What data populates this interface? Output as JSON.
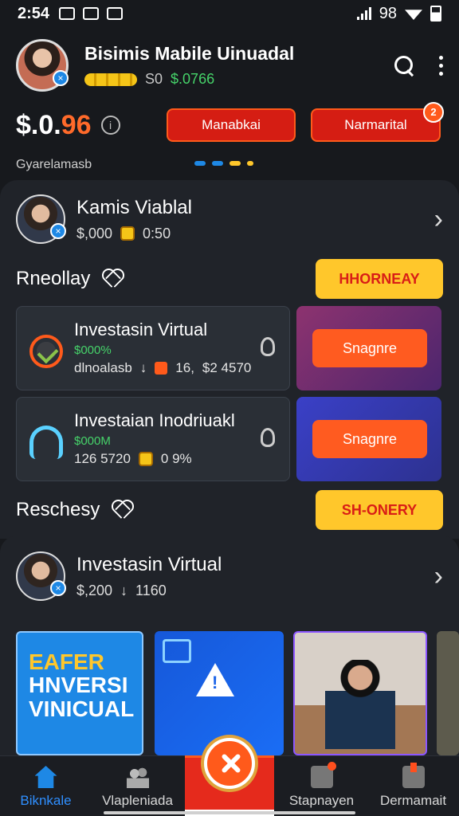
{
  "status_bar": {
    "time": "2:54",
    "right_text": "98"
  },
  "header": {
    "app_name": "Bisimis Mabile Uinuadal",
    "meta_left": "S0",
    "meta_value": "$.0766"
  },
  "balance": {
    "main_prefix": "$.0.",
    "main_accent": "96",
    "button_left": "Manabkai",
    "button_right": "Narmarital",
    "badge_count": "2",
    "subtitle": "Gyarelamasb"
  },
  "top_user": {
    "name": "Kamis Viablal",
    "amount": "$,000",
    "stat": "0:50"
  },
  "section_one": {
    "title": "Rneollay",
    "button": "HHORNEAY"
  },
  "investments": [
    {
      "title": "Investasin Virtual",
      "subtitle": "$000%",
      "meta_text": "dlnoalasb",
      "meta_number": "16,",
      "meta_value": "$2 4570",
      "action": "Snagnre"
    },
    {
      "title": "Investaian Inodriuakl",
      "subtitle": "$000M",
      "meta_text": "126 5720",
      "meta_number": "",
      "meta_value": "0 9%",
      "action": "Snagnre"
    }
  ],
  "section_two": {
    "title": "Reschesy",
    "button": "SH-ONERY"
  },
  "featured_user": {
    "name": "Investasin Virtual",
    "amount": "$,200",
    "stat": "1160"
  },
  "thumbnails": {
    "first_text_1": "EAFER",
    "first_text_2": "HNVERSI",
    "first_text_3": "VINICUAL"
  },
  "bottom_nav": {
    "home": "Biknkale",
    "vip": "Vlapleniada",
    "stap": "Stapnayen",
    "dem": "Dermamait"
  },
  "colors": {
    "accent_orange": "#ff5a1b",
    "accent_red": "#d51d13",
    "accent_yellow": "#ffc72b",
    "accent_blue": "#1e88e5",
    "success_green": "#46d36a"
  },
  "icons": [
    "search-icon",
    "more-icon",
    "heart-icon",
    "chevron-right-icon",
    "close-icon",
    "home-icon",
    "people-icon",
    "notification-icon",
    "bag-icon"
  ]
}
